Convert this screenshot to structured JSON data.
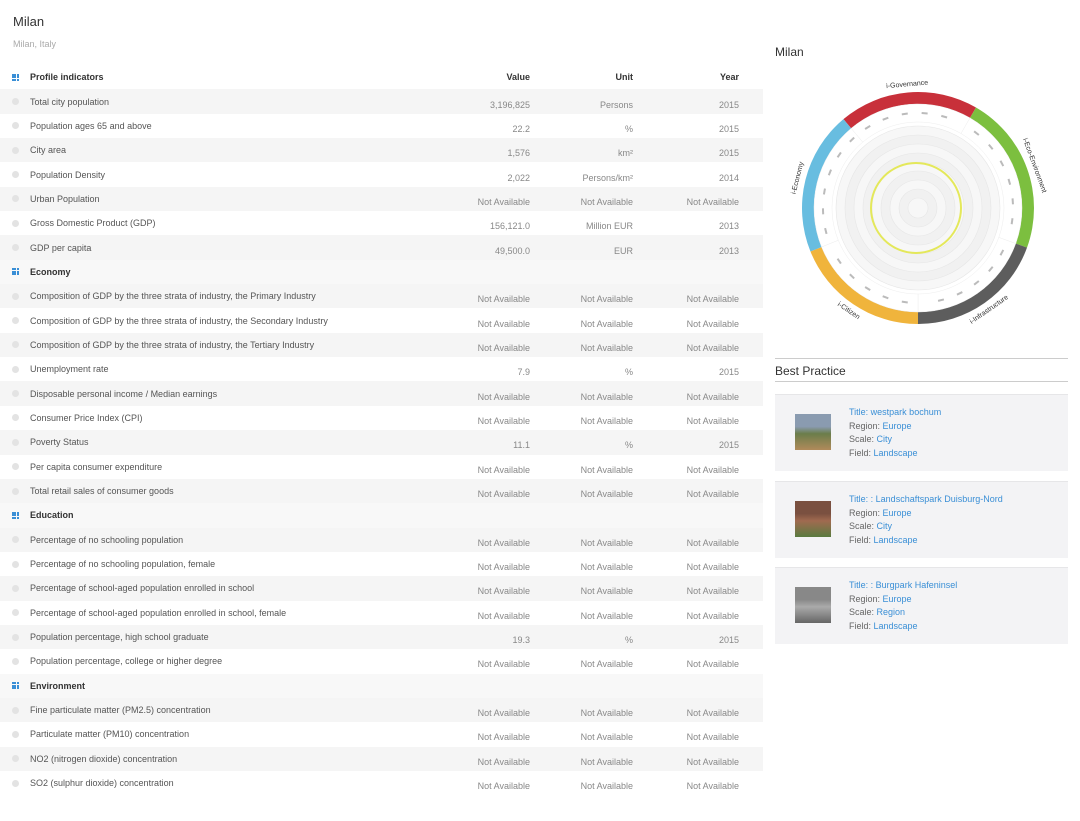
{
  "header": {
    "title": "Milan",
    "subtitle": "Milan, Italy"
  },
  "table": {
    "columns": {
      "name": "Profile indicators",
      "value": "Value",
      "unit": "Unit",
      "year": "Year"
    },
    "sections": [
      {
        "type": "rows",
        "rows": [
          {
            "name": "Total city population",
            "value": "3,196,825",
            "unit": "Persons",
            "year": "2015"
          },
          {
            "name": "Population ages 65 and above",
            "value": "22.2",
            "unit": "%",
            "year": "2015"
          },
          {
            "name": "City area",
            "value": "1,576",
            "unit": "km²",
            "year": "2015"
          },
          {
            "name": "Population Density",
            "value": "2,022",
            "unit": "Persons/km²",
            "year": "2014"
          },
          {
            "name": "Urban Population",
            "value": "Not Available",
            "unit": "Not Available",
            "year": "Not Available"
          },
          {
            "name": "Gross Domestic Product (GDP)",
            "value": "156,121.0",
            "unit": "Million EUR",
            "year": "2013"
          },
          {
            "name": "GDP per capita",
            "value": "49,500.0",
            "unit": "EUR",
            "year": "2013"
          }
        ]
      },
      {
        "type": "section",
        "title": "Economy",
        "rows": [
          {
            "name": "Composition of GDP by the three strata of industry, the Primary Industry",
            "value": "Not Available",
            "unit": "Not Available",
            "year": "Not Available"
          },
          {
            "name": "Composition of GDP by the three strata of industry, the Secondary Industry",
            "value": "Not Available",
            "unit": "Not Available",
            "year": "Not Available"
          },
          {
            "name": "Composition of GDP by the three strata of industry, the Tertiary Industry",
            "value": "Not Available",
            "unit": "Not Available",
            "year": "Not Available"
          },
          {
            "name": "Unemployment rate",
            "value": "7.9",
            "unit": "%",
            "year": "2015"
          },
          {
            "name": "Disposable personal income / Median earnings",
            "value": "Not Available",
            "unit": "Not Available",
            "year": "Not Available"
          },
          {
            "name": "Consumer Price Index (CPI)",
            "value": "Not Available",
            "unit": "Not Available",
            "year": "Not Available"
          },
          {
            "name": "Poverty Status",
            "value": "11.1",
            "unit": "%",
            "year": "2015"
          },
          {
            "name": "Per capita consumer expenditure",
            "value": "Not Available",
            "unit": "Not Available",
            "year": "Not Available"
          },
          {
            "name": "Total retail sales of consumer goods",
            "value": "Not Available",
            "unit": "Not Available",
            "year": "Not Available"
          }
        ]
      },
      {
        "type": "section",
        "title": "Education",
        "rows": [
          {
            "name": "Percentage of no schooling population",
            "value": "Not Available",
            "unit": "Not Available",
            "year": "Not Available"
          },
          {
            "name": "Percentage of no schooling population, female",
            "value": "Not Available",
            "unit": "Not Available",
            "year": "Not Available"
          },
          {
            "name": "Percentage of school-aged population enrolled in school",
            "value": "Not Available",
            "unit": "Not Available",
            "year": "Not Available"
          },
          {
            "name": "Percentage of school-aged population enrolled in school, female",
            "value": "Not Available",
            "unit": "Not Available",
            "year": "Not Available"
          },
          {
            "name": "Population percentage, high school graduate",
            "value": "19.3",
            "unit": "%",
            "year": "2015"
          },
          {
            "name": "Population percentage, college or higher degree",
            "value": "Not Available",
            "unit": "Not Available",
            "year": "Not Available"
          }
        ]
      },
      {
        "type": "section",
        "title": "Environment",
        "rows": [
          {
            "name": "Fine particulate matter (PM2.5) concentration",
            "value": "Not Available",
            "unit": "Not Available",
            "year": "Not Available"
          },
          {
            "name": "Particulate matter (PM10) concentration",
            "value": "Not Available",
            "unit": "Not Available",
            "year": "Not Available"
          },
          {
            "name": "NO2 (nitrogen dioxide) concentration",
            "value": "Not Available",
            "unit": "Not Available",
            "year": "Not Available"
          },
          {
            "name": "SO2 (sulphur dioxide) concentration",
            "value": "Not Available",
            "unit": "Not Available",
            "year": "Not Available"
          }
        ]
      }
    ]
  },
  "wheel": {
    "title": "Milan",
    "segments": [
      {
        "name": "i-Governance",
        "color": "#c8303a"
      },
      {
        "name": "i-Eco-Environment",
        "color": "#7cbf3f"
      },
      {
        "name": "i-Infrastructure",
        "color": "#5d5d5d"
      },
      {
        "name": "i-Citizen",
        "color": "#f0b43c"
      },
      {
        "name": "i-Economy",
        "color": "#68bde0"
      }
    ],
    "profile_color": "#e4e85a"
  },
  "best_practice": {
    "title": "Best Practice",
    "labels": {
      "region": "Region: ",
      "scale": "Scale: ",
      "field": "Field: "
    },
    "items": [
      {
        "title": "Title: westpark bochum",
        "region": "Europe",
        "scale": "City",
        "field": "Landscape"
      },
      {
        "title": "Title: : Landschaftspark Duisburg-Nord",
        "region": "Europe",
        "scale": "City",
        "field": "Landscape"
      },
      {
        "title": "Title: : Burgpark Hafeninsel",
        "region": "Europe",
        "scale": "Region",
        "field": "Landscape"
      }
    ]
  },
  "colors": {
    "accent": "#3a8fd6"
  }
}
